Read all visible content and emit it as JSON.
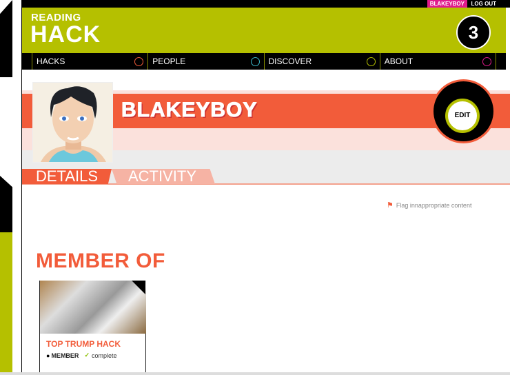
{
  "topbar": {
    "username": "BLAKEYBOY",
    "logout": "LOG OUT"
  },
  "logo": {
    "line1": "READING",
    "line2": "HACK"
  },
  "badge": "3",
  "nav": [
    {
      "label": "HACKS",
      "color": "#f25c3a"
    },
    {
      "label": "PEOPLE",
      "color": "#3bb5c8"
    },
    {
      "label": "DISCOVER",
      "color": "#b5c000"
    },
    {
      "label": "ABOUT",
      "color": "#e0198c"
    }
  ],
  "profile": {
    "name": "BLAKEYBOY",
    "edit": "EDIT"
  },
  "tabs": {
    "details": "DETAILS",
    "activity": "ACTIVITY"
  },
  "flag": "Flag innappropriate content",
  "member_of": {
    "title": "MEMBER OF",
    "cards": [
      {
        "title": "TOP TRUMP HACK",
        "role": "MEMBER",
        "status": "complete"
      }
    ]
  },
  "colors": {
    "accent": "#f25c3a",
    "green": "#b5c000",
    "pink": "#e0198c"
  }
}
